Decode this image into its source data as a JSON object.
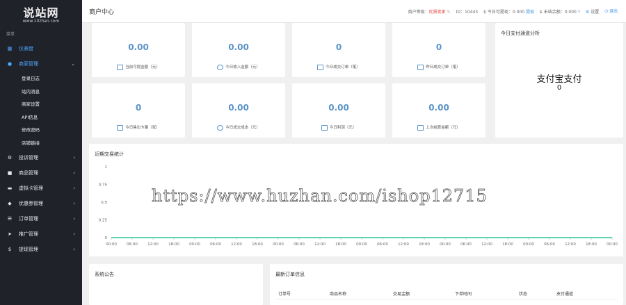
{
  "brand": {
    "name": "说站网",
    "site": "www.10zhan.com"
  },
  "sidebar": {
    "group_label": "菜单",
    "items": [
      {
        "label": "仪表盘",
        "icon": "dashboard-icon"
      },
      {
        "label": "商家管理",
        "icon": "user-icon",
        "arrow": "⌄"
      },
      {
        "label": "投诉管理",
        "icon": "gear-icon",
        "arrow": "›"
      },
      {
        "label": "商品管理",
        "icon": "bag-icon",
        "arrow": "›"
      },
      {
        "label": "虚拟卡管理",
        "icon": "card-icon",
        "arrow": "›"
      },
      {
        "label": "优惠券管理",
        "icon": "tag-icon",
        "arrow": "›"
      },
      {
        "label": "订单管理",
        "icon": "list-icon",
        "arrow": "›"
      },
      {
        "label": "推广管理",
        "icon": "send-icon",
        "arrow": "›"
      },
      {
        "label": "提现管理",
        "icon": "dollar-icon",
        "arrow": "›"
      }
    ],
    "sub_items": [
      "登录日志",
      "站内消息",
      "商家设置",
      "API信息",
      "修改密码",
      "店铺链接"
    ]
  },
  "header": {
    "title": "商户中心",
    "level_label": "商户等级：",
    "level_value": "优质卖家",
    "id_text": "ID：10443",
    "withdrawable": "$ 今日可提现：0.000",
    "withdraw_link": "提现",
    "balance": "$ 未结余额：0.000",
    "settings": "设置",
    "logout": "退出"
  },
  "stats": [
    {
      "value": "0.00",
      "label": "当前可提金额（元）",
      "icon": "wallet-icon"
    },
    {
      "value": "0.00",
      "label": "今日收入金额（元）",
      "icon": "clock-icon"
    },
    {
      "value": "0",
      "label": "今日成交订单（笔）",
      "icon": "cart-icon"
    },
    {
      "value": "0",
      "label": "昨日成交订单（笔）",
      "icon": "calendar-icon"
    },
    {
      "value": "0",
      "label": "今日售出卡量（张）",
      "icon": "card-icon"
    },
    {
      "value": "0.00",
      "label": "今日成交成本（元）",
      "icon": "database-icon"
    },
    {
      "value": "0.00",
      "label": "今日利润（元）",
      "icon": "chart-icon"
    },
    {
      "value": "0.00",
      "label": "上次结算金额（元）",
      "icon": "settle-icon"
    }
  ],
  "channel_panel": {
    "title": "今日支付通道分析",
    "channel": "支付宝支付",
    "count": "0"
  },
  "trade_panel": {
    "title": "近期交易统计"
  },
  "chart_data": {
    "type": "line",
    "x": [
      "00:00",
      "06:00",
      "12:00",
      "18:00",
      "00:00",
      "06:00",
      "12:00",
      "18:00",
      "00:00",
      "06:00",
      "12:00",
      "18:00",
      "00:00",
      "06:00",
      "12:00",
      "18:00",
      "00:00",
      "06:00",
      "12:00",
      "18:00",
      "00:00",
      "06:00",
      "12:00",
      "18:00",
      "00:00"
    ],
    "values": [
      0,
      0,
      0,
      0,
      0,
      0,
      0,
      0,
      0,
      0,
      0,
      0,
      0,
      0,
      0,
      0,
      0,
      0,
      0,
      0,
      0,
      0,
      0,
      0,
      0
    ],
    "y_ticks": [
      "1",
      "0.75",
      "0.5",
      "0.25",
      "0"
    ],
    "ylim": [
      0,
      1
    ],
    "line_color": "#5fd2b2"
  },
  "watermark": "https://www.huzhan.com/ishop12715",
  "notice_panel": {
    "title": "系统公告"
  },
  "orders_panel": {
    "title": "最新订单信息",
    "columns": [
      "订单号",
      "商品名称",
      "交易金额",
      "下单时间",
      "状态",
      "支付通道"
    ]
  }
}
